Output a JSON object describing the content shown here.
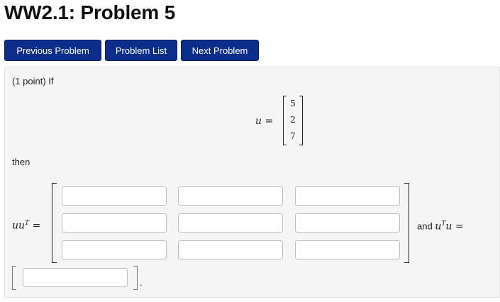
{
  "page": {
    "title": "WW2.1: Problem 5"
  },
  "nav": {
    "previous_label": "Previous Problem",
    "list_label": "Problem List",
    "next_label": "Next Problem"
  },
  "problem": {
    "intro": "(1 point) If",
    "u_label": "u =",
    "u_values": [
      "5",
      "2",
      "7"
    ],
    "then": "then",
    "outer_label_base": "uu",
    "outer_label_sup": "T",
    "outer_label_eq": "=",
    "and_text": "and",
    "inner_label_u1": "u",
    "inner_label_sup": "T",
    "inner_label_u2": "u =",
    "period": "."
  },
  "answers": {
    "matrix": [
      [
        "",
        "",
        ""
      ],
      [
        "",
        "",
        ""
      ],
      [
        "",
        "",
        ""
      ]
    ],
    "scalar": ""
  }
}
